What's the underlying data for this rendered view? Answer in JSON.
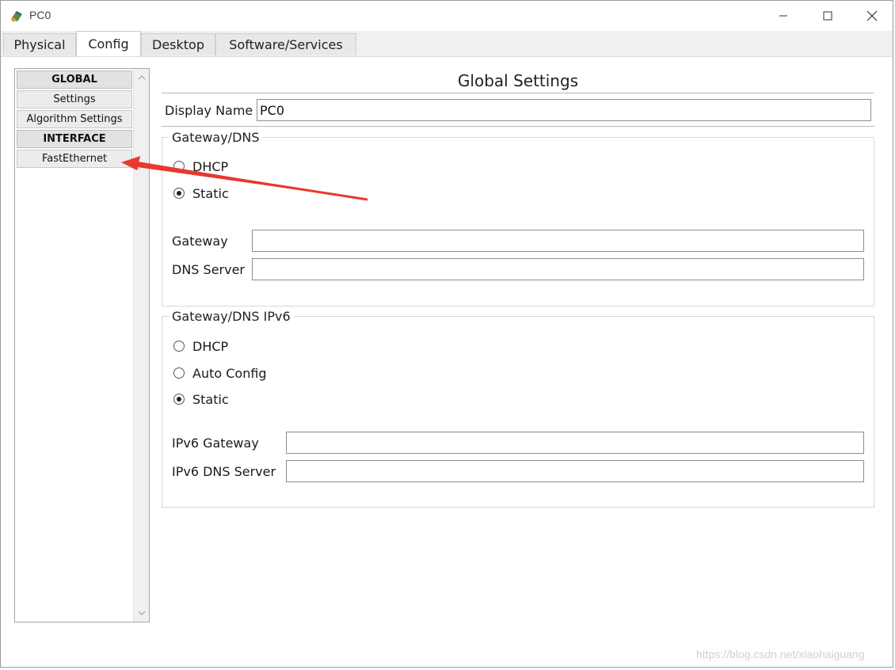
{
  "window": {
    "title": "PC0",
    "controls": {
      "minimize_icon": "minimize-icon",
      "maximize_icon": "maximize-icon",
      "close_icon": "close-icon"
    }
  },
  "tabs": [
    {
      "label": "Physical",
      "active": false
    },
    {
      "label": "Config",
      "active": true
    },
    {
      "label": "Desktop",
      "active": false
    },
    {
      "label": "Software/Services",
      "active": false
    }
  ],
  "sidebar": {
    "items": [
      {
        "label": "GLOBAL",
        "type": "header"
      },
      {
        "label": "Settings",
        "type": "item"
      },
      {
        "label": "Algorithm Settings",
        "type": "item"
      },
      {
        "label": "INTERFACE",
        "type": "header"
      },
      {
        "label": "FastEthernet",
        "type": "item"
      }
    ]
  },
  "main": {
    "title": "Global Settings",
    "display_name": {
      "label": "Display Name",
      "value": "PC0"
    },
    "gateway_dns": {
      "group_title": "Gateway/DNS",
      "options": [
        {
          "label": "DHCP",
          "checked": false
        },
        {
          "label": "Static",
          "checked": true
        }
      ],
      "gateway": {
        "label": "Gateway",
        "value": ""
      },
      "dns_server": {
        "label": "DNS Server",
        "value": ""
      }
    },
    "gateway_dns_ipv6": {
      "group_title": "Gateway/DNS IPv6",
      "options": [
        {
          "label": "DHCP",
          "checked": false
        },
        {
          "label": "Auto Config",
          "checked": false
        },
        {
          "label": "Static",
          "checked": true
        }
      ],
      "ipv6_gateway": {
        "label": "IPv6 Gateway",
        "value": ""
      },
      "ipv6_dns_server": {
        "label": "IPv6 DNS Server",
        "value": ""
      }
    }
  },
  "annotation": {
    "arrow_color": "#e8382f"
  },
  "watermark": "https://blog.csdn.net/xiaohaiguang"
}
